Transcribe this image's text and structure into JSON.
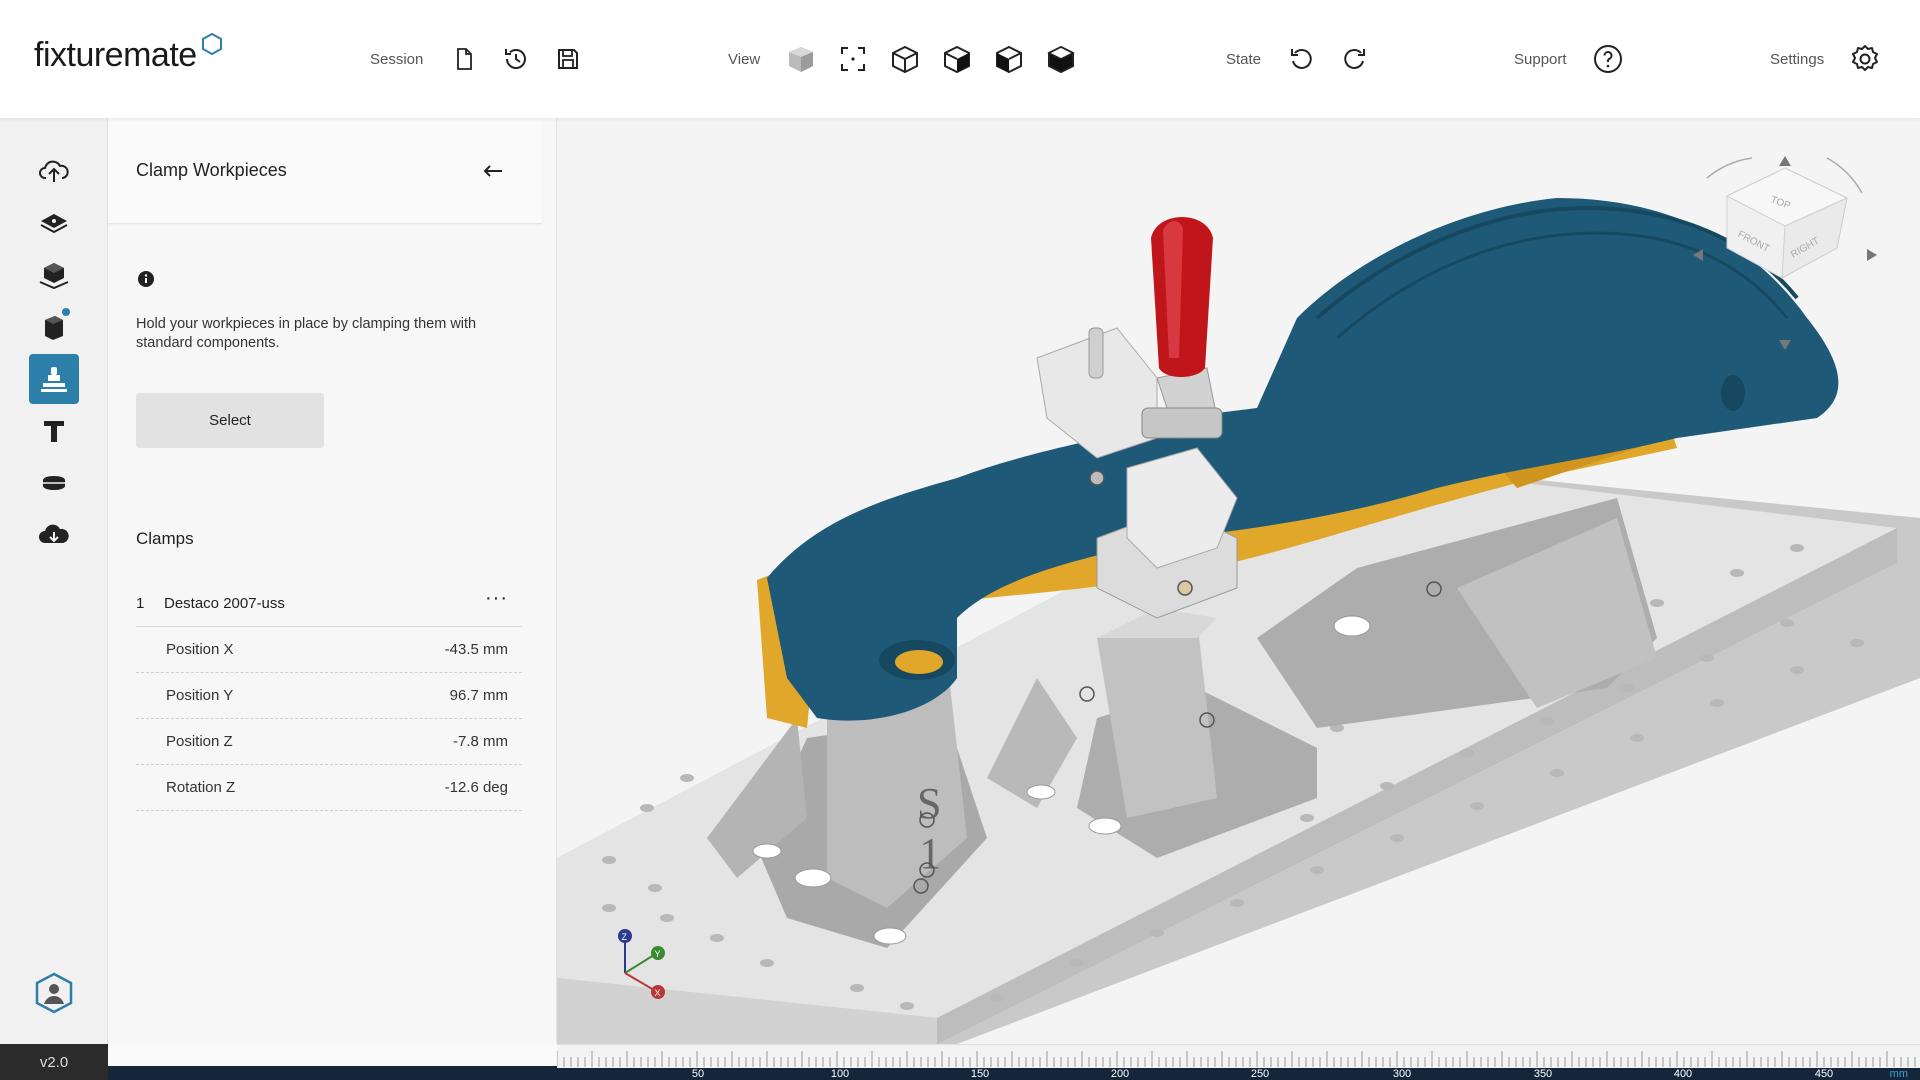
{
  "app": {
    "logo": "fixturemate",
    "version": "v2.0"
  },
  "toolbar": {
    "session_label": "Session",
    "view_label": "View",
    "state_label": "State",
    "support_label": "Support",
    "settings_label": "Settings"
  },
  "sidebar": {
    "items": [
      {
        "icon": "upload-cloud-icon"
      },
      {
        "icon": "layers-icon"
      },
      {
        "icon": "workpiece-cube-icon"
      },
      {
        "icon": "parts-icon",
        "badge": true
      },
      {
        "icon": "clamp-icon",
        "active": true
      },
      {
        "icon": "support-column-icon"
      },
      {
        "icon": "plate-icon"
      },
      {
        "icon": "download-cloud-icon"
      }
    ],
    "bottom_icon": "user-hexagon-icon"
  },
  "panel": {
    "title": "Clamp Workpieces",
    "description": "Hold your workpieces in place by clamping them with standard components.",
    "select_label": "Select",
    "clamps_title": "Clamps",
    "clamp": {
      "index": "1",
      "name": "Destaco 2007-uss",
      "more": "···",
      "properties": [
        {
          "label": "Position X",
          "value": "-43.5 mm"
        },
        {
          "label": "Position Y",
          "value": "96.7 mm"
        },
        {
          "label": "Position Z",
          "value": "-7.8 mm"
        },
        {
          "label": "Rotation Z",
          "value": "-12.6 deg"
        }
      ]
    }
  },
  "viewcube": {
    "top": "TOP",
    "front": "FRONT",
    "right": "RIGHT"
  },
  "axes": {
    "x": "X",
    "y": "Y",
    "z": "Z"
  },
  "ruler": {
    "labels": [
      "50",
      "100",
      "150",
      "200",
      "250",
      "300",
      "350",
      "400",
      "450"
    ],
    "unit": "mm"
  },
  "colors": {
    "accent": "#2c7fa8",
    "workpiece": "#1e5a78",
    "fixture": "#e0a72a",
    "clamp_handle": "#c0151b"
  }
}
